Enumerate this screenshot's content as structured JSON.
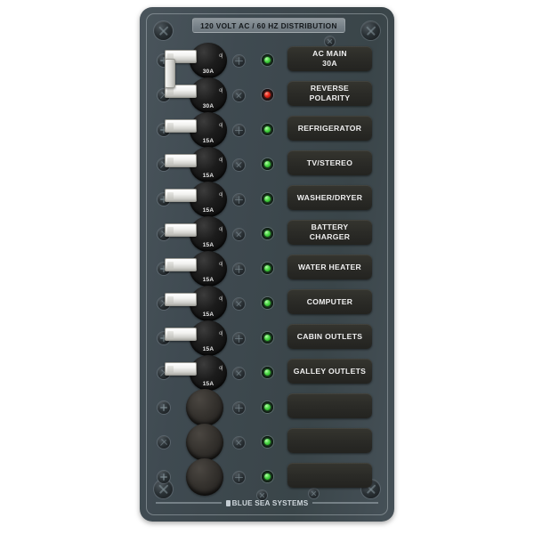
{
  "panel": {
    "header_title": "120 VOLT AC / 60 HZ DISTRIBUTION",
    "brand": "BLUE SEA SYSTEMS",
    "brand_logo_icon": "blue-sea-logo-icon",
    "colors": {
      "panel_face": "#3f4a51",
      "label_plate": "#2b2b27",
      "led_green": "#49d544",
      "led_red": "#e8281a",
      "breaker_handle": "#f2f2f0",
      "breaker_base": "#1c1c1c",
      "blank_cap": "#35322e",
      "screw": "#2a3135",
      "badge": "#79838a"
    }
  },
  "circuits": [
    {
      "label_line1": "AC MAIN",
      "label_line2": "30A",
      "breaker_rating": "30A",
      "breaker_marks": "o|",
      "led": "green",
      "control": "breaker",
      "ganged": true
    },
    {
      "label_line1": "REVERSE",
      "label_line2": "POLARITY",
      "breaker_rating": "30A",
      "breaker_marks": "o|",
      "led": "red",
      "control": "breaker",
      "ganged": true
    },
    {
      "label_line1": "REFRIGERATOR",
      "label_line2": "",
      "breaker_rating": "15A",
      "breaker_marks": "o|",
      "led": "green",
      "control": "breaker",
      "ganged": false
    },
    {
      "label_line1": "TV/STEREO",
      "label_line2": "",
      "breaker_rating": "15A",
      "breaker_marks": "o|",
      "led": "green",
      "control": "breaker",
      "ganged": false
    },
    {
      "label_line1": "WASHER/DRYER",
      "label_line2": "",
      "breaker_rating": "15A",
      "breaker_marks": "o|",
      "led": "green",
      "control": "breaker",
      "ganged": false
    },
    {
      "label_line1": "BATTERY",
      "label_line2": "CHARGER",
      "breaker_rating": "15A",
      "breaker_marks": "o|",
      "led": "green",
      "control": "breaker",
      "ganged": false
    },
    {
      "label_line1": "WATER HEATER",
      "label_line2": "",
      "breaker_rating": "15A",
      "breaker_marks": "o|",
      "led": "green",
      "control": "breaker",
      "ganged": false
    },
    {
      "label_line1": "COMPUTER",
      "label_line2": "",
      "breaker_rating": "15A",
      "breaker_marks": "o|",
      "led": "green",
      "control": "breaker",
      "ganged": false
    },
    {
      "label_line1": "CABIN OUTLETS",
      "label_line2": "",
      "breaker_rating": "15A",
      "breaker_marks": "o|",
      "led": "green",
      "control": "breaker",
      "ganged": false
    },
    {
      "label_line1": "GALLEY OUTLETS",
      "label_line2": "",
      "breaker_rating": "15A",
      "breaker_marks": "o|",
      "led": "green",
      "control": "breaker",
      "ganged": false
    },
    {
      "label_line1": "",
      "label_line2": "",
      "breaker_rating": "",
      "breaker_marks": "",
      "led": "green",
      "control": "blank",
      "ganged": false
    },
    {
      "label_line1": "",
      "label_line2": "",
      "breaker_rating": "",
      "breaker_marks": "",
      "led": "green",
      "control": "blank",
      "ganged": false
    },
    {
      "label_line1": "",
      "label_line2": "",
      "breaker_rating": "",
      "breaker_marks": "",
      "led": "green",
      "control": "blank",
      "ganged": false
    }
  ]
}
